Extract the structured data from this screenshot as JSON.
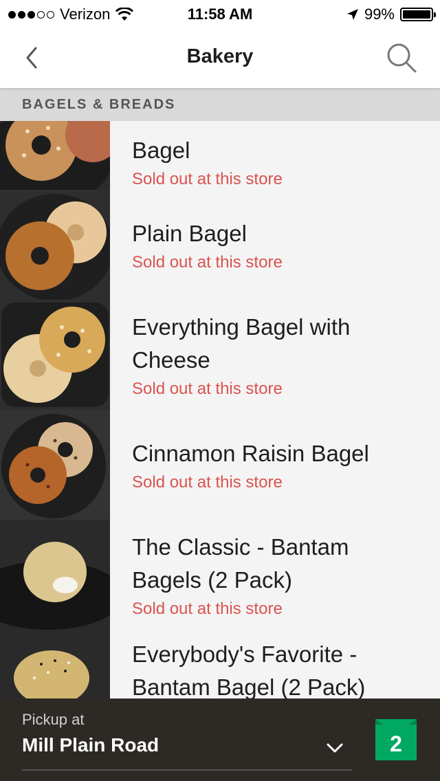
{
  "status_bar": {
    "carrier": "Verizon",
    "time": "11:58 AM",
    "battery": "99%",
    "signal_bars_filled": 3,
    "signal_bars_total": 5
  },
  "nav": {
    "title": "Bakery",
    "back_icon": "chevron-left-icon",
    "search_icon": "search-icon"
  },
  "section": {
    "title": "BAGELS & BREADS"
  },
  "items": [
    {
      "name_lines": [
        "Bagel"
      ],
      "status": "Sold out at this store"
    },
    {
      "name_lines": [
        "Plain Bagel"
      ],
      "status": "Sold out at this store"
    },
    {
      "name_lines": [
        "Everything Bagel with",
        "Cheese"
      ],
      "status": "Sold out at this store"
    },
    {
      "name_lines": [
        "Cinnamon Raisin Bagel"
      ],
      "status": "Sold out at this store"
    },
    {
      "name_lines": [
        "The Classic - Bantam",
        "Bagels (2 Pack)"
      ],
      "status": "Sold out at this store"
    },
    {
      "name_lines": [
        "Everybody's Favorite -",
        "Bantam Bagel (2 Pack)"
      ],
      "status": ""
    }
  ],
  "bottom_bar": {
    "pickup_label": "Pickup at",
    "store_name": "Mill Plain Road",
    "bag_count": "2",
    "bag_color": "#00a862"
  },
  "colors": {
    "sold_out": "#d9534f",
    "bottom_bar": "#2d2a26",
    "section_header": "#d9d9d9"
  }
}
